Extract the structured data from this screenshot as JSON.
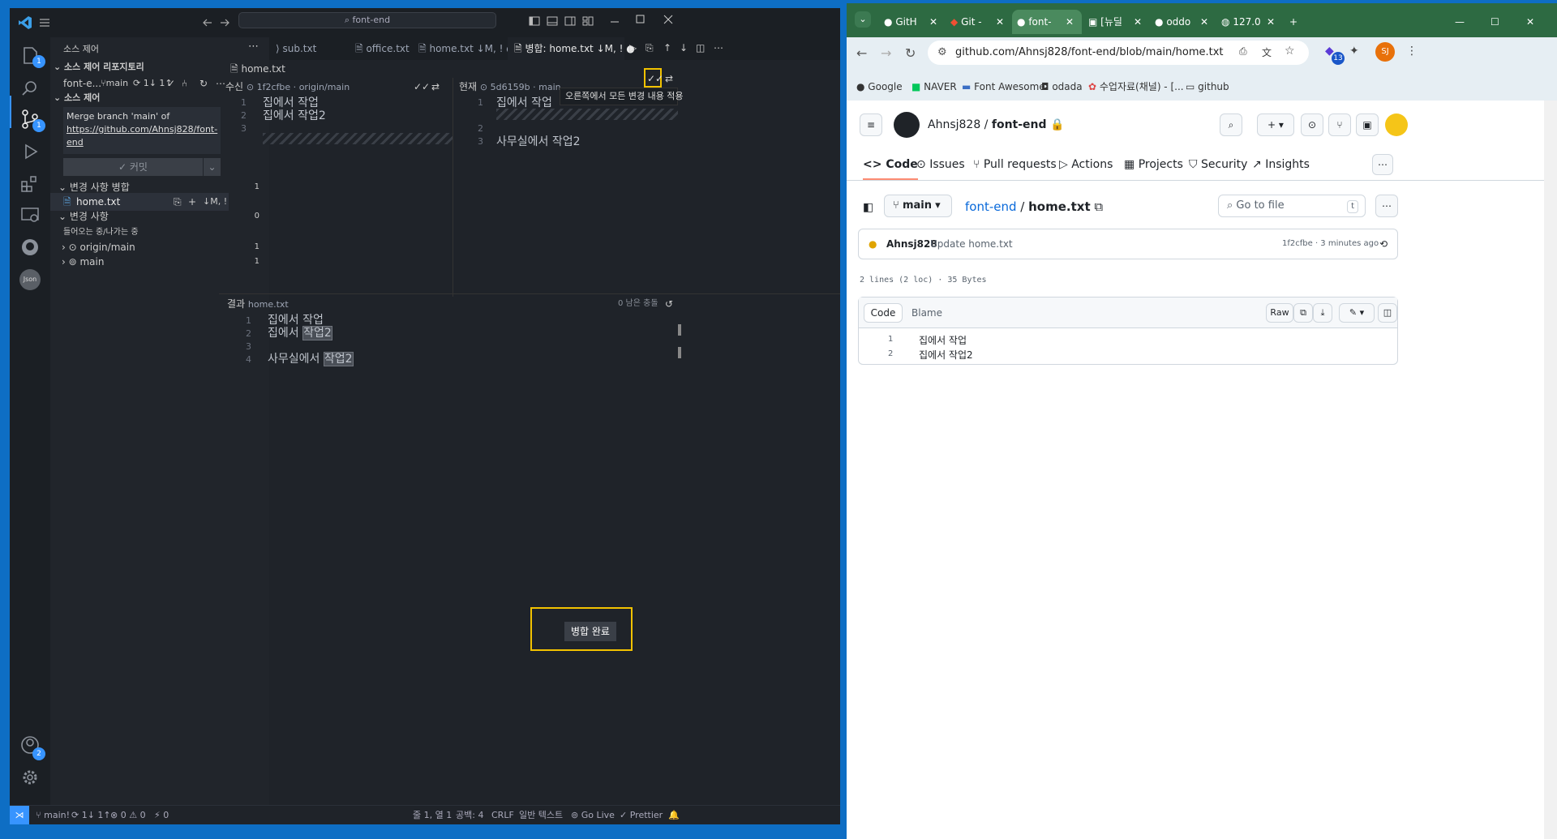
{
  "vscode": {
    "search_text": "font-end",
    "side_title": "소스 제어",
    "repos_header": "소스 제어 리포지토리",
    "repo_name": "font-e...",
    "repo_branch": "main",
    "repo_sync": "1↓ 1↑",
    "sc_header": "소스 제어",
    "commit_message_lines": [
      "Merge branch 'main' of",
      "https://github.com/Ahnsj828/font-",
      "end"
    ],
    "commit_button": "✓ 커밋",
    "merge_changes_label": "변경 사항 병합",
    "merge_changes_count": "1",
    "merge_file": "home.txt",
    "merge_file_status": "↓M, !",
    "changes_label": "변경 사항",
    "changes_count": "0",
    "incoming_label": "들어오는 중/나가는 중",
    "branches": [
      {
        "label": "origin/main",
        "count": "1"
      },
      {
        "label": "main",
        "count": "1"
      }
    ],
    "tabs": [
      {
        "label": "sub.txt"
      },
      {
        "label": "office.txt"
      },
      {
        "label": "home.txt ↓M, !"
      },
      {
        "label": "병합: home.txt ↓M, !"
      }
    ],
    "breadcrumb": "home.txt",
    "incoming": {
      "label": "수신",
      "commit": "1f2cfbe",
      "ref": "origin/main",
      "lines": [
        {
          "n": "1",
          "t": "집에서 작업"
        },
        {
          "n": "2",
          "t": "집에서 작업2"
        },
        {
          "n": "3",
          "t": ""
        }
      ]
    },
    "current": {
      "label": "현재",
      "commit": "5d6159b",
      "ref": "main",
      "lines": [
        {
          "n": "1",
          "t": "집에서 작업"
        },
        {
          "n": "2",
          "t": ""
        },
        {
          "n": "3",
          "t": "사무실에서 작업2"
        }
      ]
    },
    "tooltip": "오른쪽에서 모든 변경 내용 적용",
    "result": {
      "label": "결과",
      "file": "home.txt",
      "conflicts": "0 남은 충돌",
      "lines": [
        {
          "n": "1",
          "a": "집에서 작업",
          "b": ""
        },
        {
          "n": "2",
          "a": "집에서 ",
          "b": "작업2"
        },
        {
          "n": "3",
          "a": "",
          "b": ""
        },
        {
          "n": "4",
          "a": "사무실에서 ",
          "b": "작업2"
        }
      ]
    },
    "complete_merge": "병합 완료",
    "activity_badges": {
      "explorer": "1",
      "scm": "1",
      "accounts": "2"
    },
    "status": {
      "branch": "main!",
      "sync": "1↓ 1↑",
      "problems": "⊗ 0 ⚠ 0",
      "ports": "0",
      "position": "줄 1, 열 1",
      "spaces": "공백: 4",
      "eol": "CRLF",
      "lang": "일반 텍스트",
      "golive": "Go Live",
      "prettier": "Prettier"
    }
  },
  "chrome": {
    "tabs": [
      {
        "label": "GitH"
      },
      {
        "label": "Git -"
      },
      {
        "label": "font-"
      },
      {
        "label": "[뉴딜"
      },
      {
        "label": "oddo"
      },
      {
        "label": "127.0"
      }
    ],
    "url": "github.com/Ahnsj828/font-end/blob/main/home.txt",
    "ext_badge": "13",
    "profile": "SJ",
    "bookmarks": [
      "Google",
      "NAVER",
      "Font Awesome",
      "odada",
      "수업자료(채널) - [...",
      "github"
    ],
    "accent": "#2d6a42"
  },
  "github": {
    "owner": "Ahnsj828",
    "repo": "font-end",
    "nav": [
      "Code",
      "Issues",
      "Pull requests",
      "Actions",
      "Projects",
      "Security",
      "Insights"
    ],
    "branch": "main",
    "path_repo": "font-end",
    "path_file": "home.txt",
    "goto_placeholder": "Go to file",
    "goto_key": "t",
    "commit_author": "Ahnsj828",
    "commit_msg": "Update home.txt",
    "commit_meta": "1f2cfbe · 3 minutes ago",
    "file_info": "2 lines (2 loc) · 35 Bytes",
    "view_tabs": [
      "Code",
      "Blame"
    ],
    "raw": "Raw",
    "lines": [
      {
        "n": "1",
        "t": "집에서 작업"
      },
      {
        "n": "2",
        "t": "집에서 작업2"
      }
    ]
  }
}
